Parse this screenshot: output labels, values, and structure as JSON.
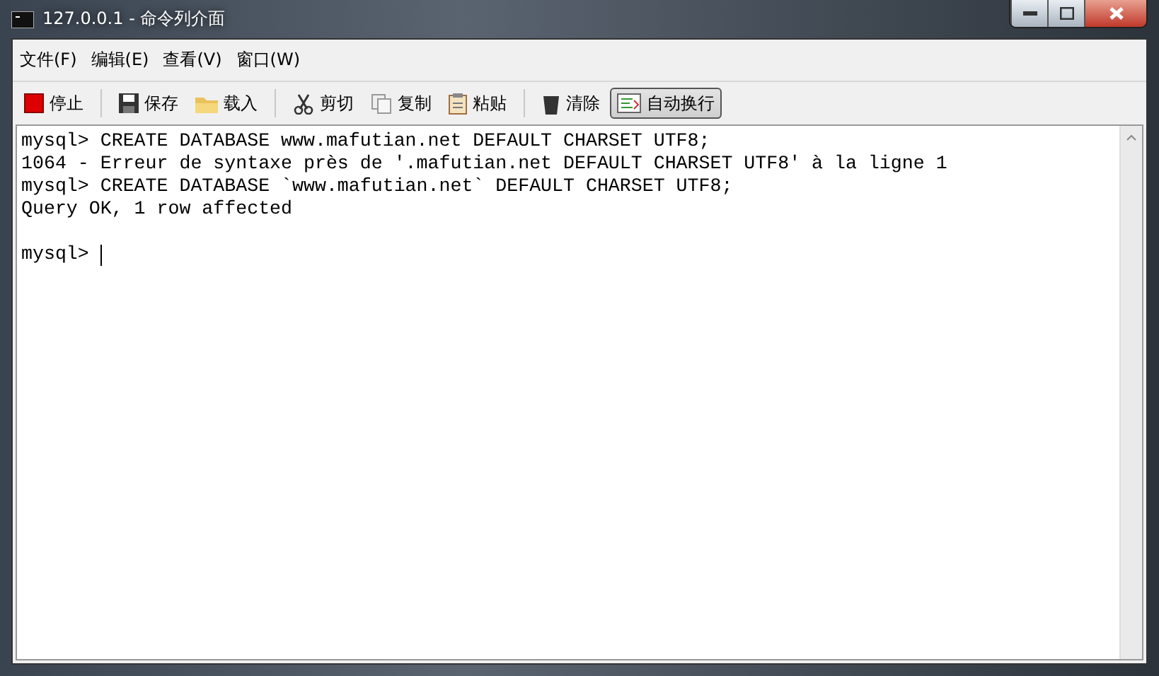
{
  "window": {
    "title": "127.0.0.1 - 命令列介面"
  },
  "menu": [
    "文件(F)",
    "编辑(E)",
    "查看(V)",
    "窗口(W)"
  ],
  "toolbar": [
    [
      {
        "label": "停止",
        "selected": false
      }
    ],
    [
      {
        "label": "保存",
        "selected": false
      },
      {
        "label": "载入",
        "selected": false
      }
    ],
    [
      {
        "label": "剪切",
        "selected": false
      },
      {
        "label": "复制",
        "selected": false
      },
      {
        "label": "粘贴",
        "selected": false
      }
    ],
    [
      {
        "label": "清除",
        "selected": false
      },
      {
        "label": "自动换行",
        "selected": true
      }
    ]
  ],
  "console": {
    "lines": [
      "mysql> CREATE DATABASE www.mafutian.net DEFAULT CHARSET UTF8;",
      "1064 - Erreur de syntaxe près de '.mafutian.net DEFAULT CHARSET UTF8' à la ligne 1",
      "mysql> CREATE DATABASE `www.mafutian.net` DEFAULT CHARSET UTF8;",
      "Query OK, 1 row affected"
    ],
    "prompt": "mysql> "
  }
}
